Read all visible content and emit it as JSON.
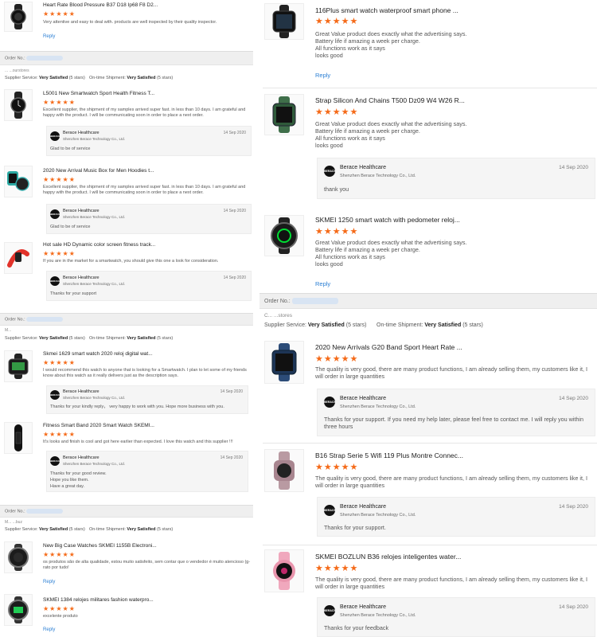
{
  "labels": {
    "order_no": "Order No.:",
    "supplier_service": "Supplier Service:",
    "on_time_shipment": "On-time Shipment:",
    "very_satisfied": "Very Satisfied",
    "stars_5": "(5 stars)",
    "reply": "Reply",
    "stars": "★★★★★"
  },
  "supplier": {
    "name": "Berace Healthcare",
    "company": "Shenzhen Berace Technology Co., Ltd.",
    "logo_text": "BERACE"
  },
  "left": {
    "order1": {
      "buyer": "... ...ourstores"
    },
    "order2": {
      "buyer": "M..."
    },
    "order3": {
      "buyer": "M...  ...buz"
    },
    "items": [
      {
        "title": "Heart Rate Blood Pressure B37 D18 Ip68 F8 D2...",
        "review": "Very attentive and easy to deal with. products are well inspected by their quality inspector."
      },
      {
        "title": "L5001 New Smartwatch Sport Health Fitness T...",
        "review": "Excellent supplier, the shipment of my samples arrived super fast. in less than 10 days. I am grateful and happy with the product. I will be communicating soon in order to place a next order.",
        "reply_date": "14 Sep 2020",
        "reply_text": "Glad to be of service"
      },
      {
        "title": "2020 New Arrival Music Box for Men Hoodies t...",
        "review": "Excellent supplier, the shipment of my samples arrived super fast. in less than 10 days. I am grateful and happy with the product. I will be communicating soon in order to place a next order.",
        "reply_date": "14 Sep 2020",
        "reply_text": "Glad to be of service"
      },
      {
        "title": "Hot sale HD Dynamic color screen fitness track...",
        "review": "If you are in the market for a smartwatch, you should give this one a look for consideration.",
        "reply_date": "14 Sep 2020",
        "reply_text": "Thanks for your support"
      },
      {
        "title": "Skmei 1629 smart watch 2020 reloj digital wat...",
        "review": "I would recommend this watch to anyone that is looking for a Smartwatch. I plan to let some of my friends know about this watch as it really delivers just as the description says.",
        "reply_date": "14 Sep 2020",
        "reply_text": "Thanks for your kindly reply，   very happy to work with you. Hope more business with you."
      },
      {
        "title": "Fitness Smart Band 2020 Smart Watch SKEMI...",
        "review": "It's looks and finish is cool and got here earlier than expected. I love this watch and this supplier !!!",
        "reply_date": "14 Sep 2020",
        "reply_lines": [
          "Thanks for your good review.",
          "Hope you like them.",
          "Have a great day."
        ]
      },
      {
        "title": "New Big Case Watches SKMEI 1155B Electroni...",
        "review": "os produtos são de alta qualidade, estou muito satisfeito, sem contar que o vendedor é muito atencioso (g-rato por tudo!"
      },
      {
        "title": "SKMEI 1384 relojes militares fashion waterpro...",
        "review": "excelente produto"
      }
    ]
  },
  "right": {
    "order": {
      "buyer": "C...  ...stores"
    },
    "items": [
      {
        "title": "116Plus smart watch waterproof smart phone ...",
        "review_lines": [
          "Great Value product does exactly what the advertising says.",
          "Battery life if amazing a week per charge.",
          "All functions work as it says",
          "looks good"
        ]
      },
      {
        "title": "Strap Silicon And Chains T500 Dz09 W4 W26 R...",
        "review_lines": [
          "Great Value product does exactly what the advertising says.",
          "Battery life if amazing a week per charge.",
          "All functions work as it says",
          "looks good"
        ],
        "reply_date": "14 Sep 2020",
        "reply_text": "thank you"
      },
      {
        "title": "SKMEI 1250 smart watch with pedometer reloj...",
        "review_lines": [
          "Great Value product does exactly what the advertising says.",
          "Battery life if amazing a week per charge.",
          "All functions work as it says",
          "looks good"
        ]
      },
      {
        "title": "2020 New Arrivals G20 Band Sport Heart Rate ...",
        "review": "The quality is very good, there are many product functions, I am already selling them, my customers like it, I will order in large quantities",
        "reply_date": "14 Sep 2020",
        "reply_text": "Thanks for your support. If you need my help later, please feel free to contact me. I will reply you within three hours"
      },
      {
        "title": "B16 Strap Serie 5 Wifi 119 Plus Montre Connec...",
        "review": "The quality is very good, there are many product functions, I am already selling them, my customers like it, I will order in large quantities",
        "reply_date": "14 Sep 2020",
        "reply_text": "Thanks for your support."
      },
      {
        "title": "SKMEI BOZLUN B36 relojes inteligentes water...",
        "review": "The quality is very good, there are many product functions, I am already selling them, my customers like it, I will order in large quantities",
        "reply_date": "14 Sep 2020",
        "reply_text": "Thanks for your feedback"
      }
    ]
  },
  "colors": {
    "star": "#f56a18",
    "link": "#2b7fd4",
    "order_bar": "#efefef"
  },
  "icons": [
    "smartwatch-icon",
    "supplier-logo-icon"
  ]
}
